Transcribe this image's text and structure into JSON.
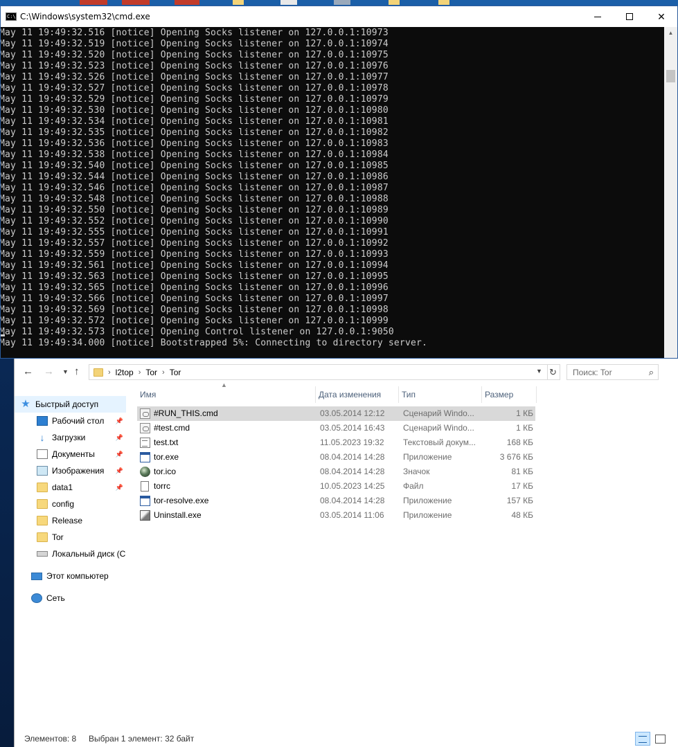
{
  "cmd": {
    "title": "C:\\Windows\\system32\\cmd.exe",
    "lines": [
      "May 11 19:49:32.516 [notice] Opening Socks listener on 127.0.0.1:10973",
      "May 11 19:49:32.519 [notice] Opening Socks listener on 127.0.0.1:10974",
      "May 11 19:49:32.520 [notice] Opening Socks listener on 127.0.0.1:10975",
      "May 11 19:49:32.523 [notice] Opening Socks listener on 127.0.0.1:10976",
      "May 11 19:49:32.526 [notice] Opening Socks listener on 127.0.0.1:10977",
      "May 11 19:49:32.527 [notice] Opening Socks listener on 127.0.0.1:10978",
      "May 11 19:49:32.529 [notice] Opening Socks listener on 127.0.0.1:10979",
      "May 11 19:49:32.530 [notice] Opening Socks listener on 127.0.0.1:10980",
      "May 11 19:49:32.534 [notice] Opening Socks listener on 127.0.0.1:10981",
      "May 11 19:49:32.535 [notice] Opening Socks listener on 127.0.0.1:10982",
      "May 11 19:49:32.536 [notice] Opening Socks listener on 127.0.0.1:10983",
      "May 11 19:49:32.538 [notice] Opening Socks listener on 127.0.0.1:10984",
      "May 11 19:49:32.540 [notice] Opening Socks listener on 127.0.0.1:10985",
      "May 11 19:49:32.544 [notice] Opening Socks listener on 127.0.0.1:10986",
      "May 11 19:49:32.546 [notice] Opening Socks listener on 127.0.0.1:10987",
      "May 11 19:49:32.548 [notice] Opening Socks listener on 127.0.0.1:10988",
      "May 11 19:49:32.550 [notice] Opening Socks listener on 127.0.0.1:10989",
      "May 11 19:49:32.552 [notice] Opening Socks listener on 127.0.0.1:10990",
      "May 11 19:49:32.555 [notice] Opening Socks listener on 127.0.0.1:10991",
      "May 11 19:49:32.557 [notice] Opening Socks listener on 127.0.0.1:10992",
      "May 11 19:49:32.559 [notice] Opening Socks listener on 127.0.0.1:10993",
      "May 11 19:49:32.561 [notice] Opening Socks listener on 127.0.0.1:10994",
      "May 11 19:49:32.563 [notice] Opening Socks listener on 127.0.0.1:10995",
      "May 11 19:49:32.565 [notice] Opening Socks listener on 127.0.0.1:10996",
      "May 11 19:49:32.566 [notice] Opening Socks listener on 127.0.0.1:10997",
      "May 11 19:49:32.569 [notice] Opening Socks listener on 127.0.0.1:10998",
      "May 11 19:49:32.572 [notice] Opening Socks listener on 127.0.0.1:10999",
      "May 11 19:49:32.573 [notice] Opening Control listener on 127.0.0.1:9050",
      "May 11 19:49:34.000 [notice] Bootstrapped 5%: Connecting to directory server."
    ],
    "colors": {
      "background": "#0c0c0c",
      "text": "#cccccc"
    }
  },
  "explorer": {
    "breadcrumb": [
      "l2top",
      "Tor",
      "Tor"
    ],
    "search_placeholder": "Поиск: Tor",
    "nav": {
      "quick_access": "Быстрый доступ",
      "items": [
        {
          "label": "Рабочий стол",
          "icon": "desktop-icon",
          "pinned": true
        },
        {
          "label": "Загрузки",
          "icon": "download-icon",
          "pinned": true
        },
        {
          "label": "Документы",
          "icon": "documents-icon",
          "pinned": true
        },
        {
          "label": "Изображения",
          "icon": "pictures-icon",
          "pinned": true
        },
        {
          "label": "data1",
          "icon": "folder-icon",
          "pinned": true
        },
        {
          "label": "config",
          "icon": "folder-icon",
          "pinned": false
        },
        {
          "label": "Release",
          "icon": "folder-icon",
          "pinned": false
        },
        {
          "label": "Tor",
          "icon": "folder-icon",
          "pinned": false
        },
        {
          "label": "Локальный диск (C",
          "icon": "disk-icon",
          "pinned": false
        }
      ],
      "this_pc": "Этот компьютер",
      "network": "Сеть"
    },
    "columns": {
      "name": "Имя",
      "date": "Дата изменения",
      "type": "Тип",
      "size": "Размер"
    },
    "files": [
      {
        "name": "#RUN_THIS.cmd",
        "date": "03.05.2014 12:12",
        "type": "Сценарий Windo...",
        "size": "1 КБ",
        "icon": "cmd-file-icon",
        "selected": true
      },
      {
        "name": "#test.cmd",
        "date": "03.05.2014 16:43",
        "type": "Сценарий Windo...",
        "size": "1 КБ",
        "icon": "cmd-file-icon",
        "selected": false
      },
      {
        "name": "test.txt",
        "date": "11.05.2023 19:32",
        "type": "Текстовый докум...",
        "size": "168 КБ",
        "icon": "text-file-icon",
        "selected": false
      },
      {
        "name": "tor.exe",
        "date": "08.04.2014 14:28",
        "type": "Приложение",
        "size": "3 676 КБ",
        "icon": "exe-file-icon",
        "selected": false
      },
      {
        "name": "tor.ico",
        "date": "08.04.2014 14:28",
        "type": "Значок",
        "size": "81 КБ",
        "icon": "ico-file-icon",
        "selected": false
      },
      {
        "name": "torrc",
        "date": "10.05.2023 14:25",
        "type": "Файл",
        "size": "17 КБ",
        "icon": "blank-file-icon",
        "selected": false
      },
      {
        "name": "tor-resolve.exe",
        "date": "08.04.2014 14:28",
        "type": "Приложение",
        "size": "157 КБ",
        "icon": "exe-file-icon",
        "selected": false
      },
      {
        "name": "Uninstall.exe",
        "date": "03.05.2014 11:06",
        "type": "Приложение",
        "size": "48 КБ",
        "icon": "setup-file-icon",
        "selected": false
      }
    ],
    "status": {
      "count": "Элементов: 8",
      "selection": "Выбран 1 элемент: 32 байт"
    },
    "colors": {
      "selected_row": "#d9d9d9",
      "nav_selected": "#e5f3ff",
      "header_text": "#4c607a"
    }
  }
}
